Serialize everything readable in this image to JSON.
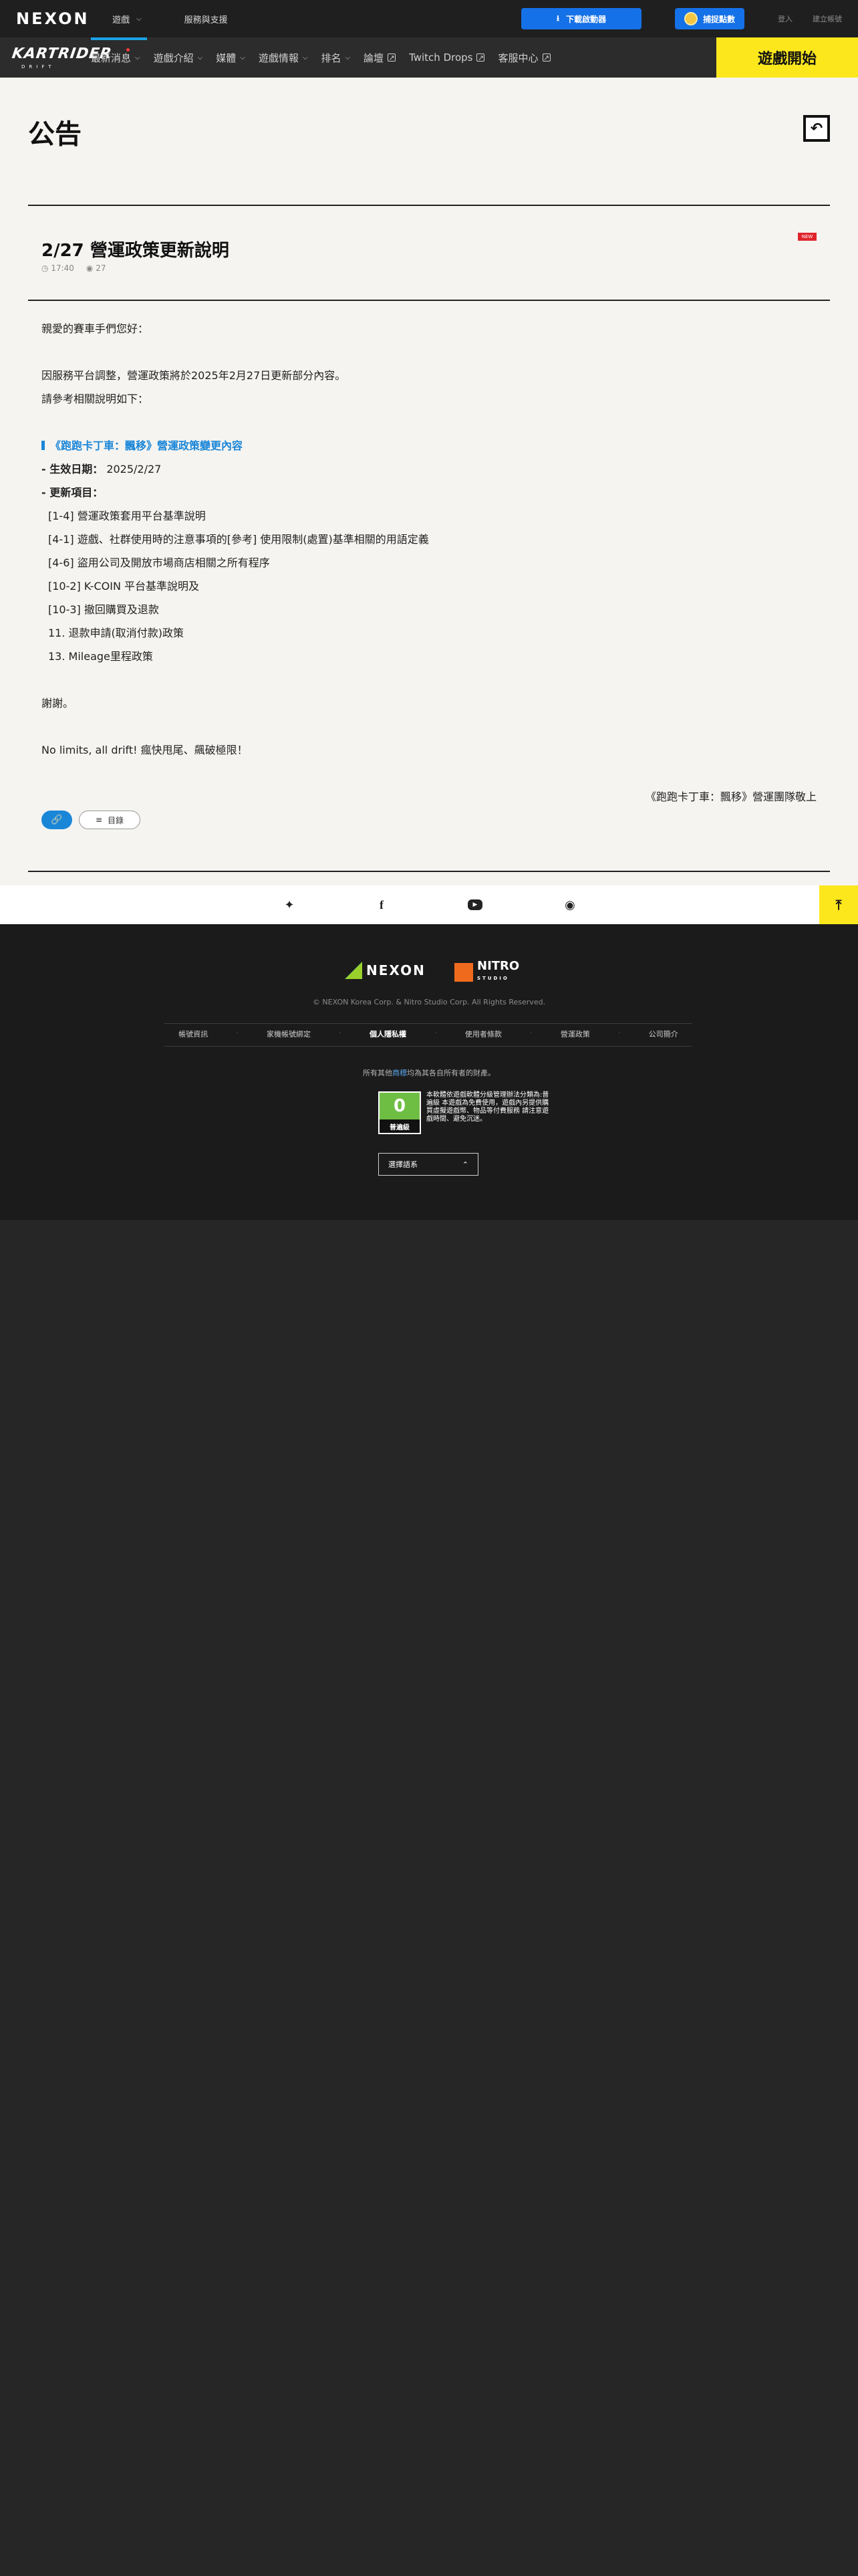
{
  "topbar": {
    "logo": "NEXON",
    "nav": [
      {
        "label": "遊戲"
      },
      {
        "label": "服務與支援"
      }
    ],
    "download_label": "下載啟動器",
    "reward_label": "捕捉點數",
    "login_label": "登入",
    "signup_label": "建立帳號"
  },
  "gamebar": {
    "logo": "KARTRIDER",
    "logo_sub": "DRIFT",
    "nav": [
      {
        "label": "最新消息"
      },
      {
        "label": "遊戲介紹"
      },
      {
        "label": "媒體"
      },
      {
        "label": "遊戲情報"
      },
      {
        "label": "排名"
      },
      {
        "label": "論壇"
      },
      {
        "label": "Twitch Drops"
      },
      {
        "label": "客服中心"
      }
    ],
    "play_label": "遊戲開始"
  },
  "page": {
    "title": "公告"
  },
  "post": {
    "title": "2/27 營運政策更新說明",
    "time": "17:40",
    "views": "27",
    "badge": "NEW",
    "lines": [
      "親愛的賽車手們您好：",
      "",
      "因服務平台調整，營運政策將於2025年2月27日更新部分內容。",
      "請參考相關說明如下：",
      "",
      "《跑跑卡丁車：飄移》營運政策變更內容",
      "- 生效日期：",
      "- 更新項目：",
      "[1-4] 營運政策套用平台基準說明",
      "[4-1] 遊戲、社群使用時的注意事項的[參考] 使用限制(處置)基準相關的用語定義",
      "[4-6] 盜用公司及開放市場商店相關之所有程序",
      "[10-2] K-COIN 平台基準說明及",
      "[10-3] 撤回購買及退款",
      "11. 退款申請(取消付款)政策",
      "13. Mileage里程政策",
      "",
      "謝謝。",
      "",
      "No limits, all drift! 瘋快甩尾、飆破極限！",
      "",
      "《跑跑卡丁車：飄移》營運團隊敬上"
    ],
    "effective_date": "2025/2/27",
    "list_label": "目錄"
  },
  "footer": {
    "nexon": "NEXON",
    "nitro": "NITRO",
    "nitro_sub": "STUDIO",
    "copyright": "© NEXON Korea Corp. & Nitro Studio Corp. All Rights Reserved.",
    "links": [
      {
        "label": "帳號資訊"
      },
      {
        "label": "家機帳號綁定"
      },
      {
        "label": "個人隱私權"
      },
      {
        "label": "使用者條款"
      },
      {
        "label": "營運政策"
      },
      {
        "label": "公司簡介"
      }
    ],
    "trademark_pre": "所有其他",
    "trademark_link": "商標",
    "trademark_post": "均為其各自所有者的財產。",
    "rating_label": "普遍級",
    "rating_text": "本軟體依遊戲軟體分級管理辦法分類為:普遍級 本遊戲為免費使用，遊戲內另提供購買虛擬遊戲幣、物品等付費服務 請注意遊戲時間、避免沉迷。",
    "language_label": "選擇語系"
  }
}
